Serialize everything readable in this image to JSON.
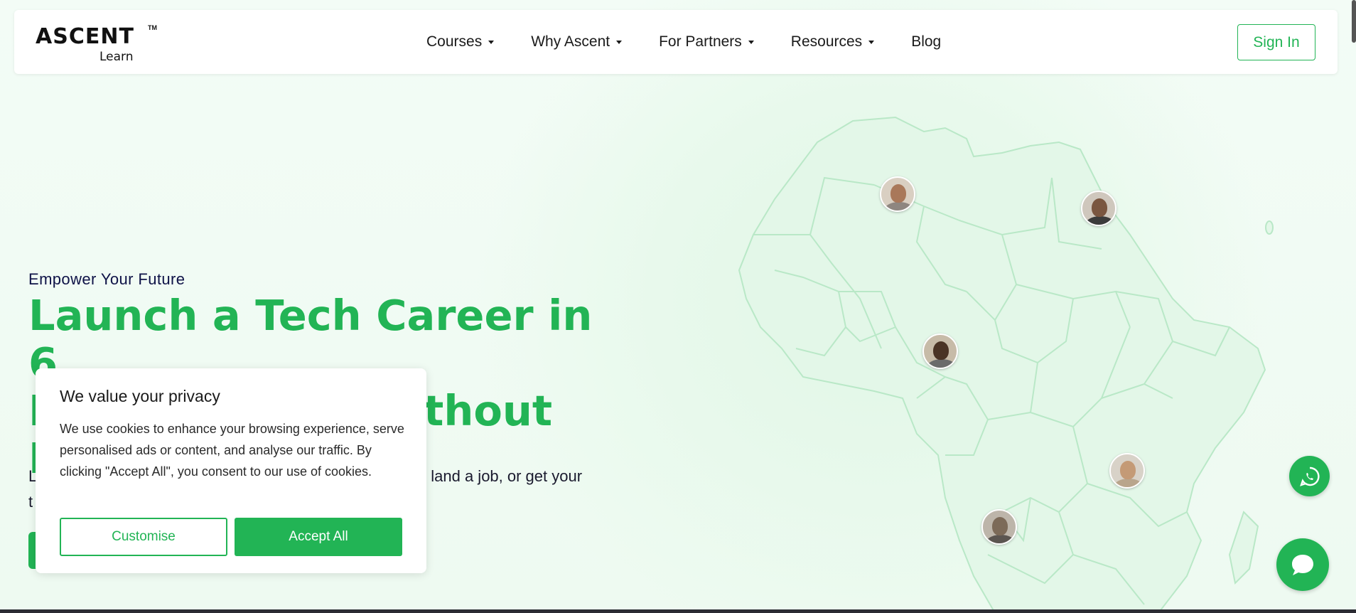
{
  "header": {
    "logo": {
      "main": "ASCENT",
      "tm": "TM",
      "sub": "Learn"
    },
    "nav": [
      {
        "label": "Courses",
        "dropdown": true
      },
      {
        "label": "Why Ascent",
        "dropdown": true
      },
      {
        "label": "For Partners",
        "dropdown": true
      },
      {
        "label": "Resources",
        "dropdown": true
      },
      {
        "label": "Blog",
        "dropdown": false
      }
    ],
    "signin_label": "Sign In"
  },
  "hero": {
    "eyebrow": "Empower Your Future",
    "headline_line1": "Launch a Tech Career in 6",
    "headline_line2": "Months, Even Without",
    "headline_line3": "I",
    "subtext_visible_right": "land a job, or get your",
    "subtext_line1_start": "L",
    "subtext_line2_start": "t"
  },
  "cookie": {
    "title": "We value your privacy",
    "text": "We use cookies to enhance your browsing experience, serve personalised ads or content, and analyse our traffic. By clicking \"Accept All\", you consent to our use of cookies.",
    "customise_label": "Customise",
    "accept_label": "Accept All"
  },
  "colors": {
    "brand_green": "#22b455",
    "navy": "#0e1247",
    "map_fill": "#e3f7e8",
    "map_stroke": "#b9e8c7"
  },
  "icons": {
    "whatsapp": "whatsapp-icon",
    "chat": "chat-bubble-icon",
    "caret": "caret-down-icon"
  }
}
